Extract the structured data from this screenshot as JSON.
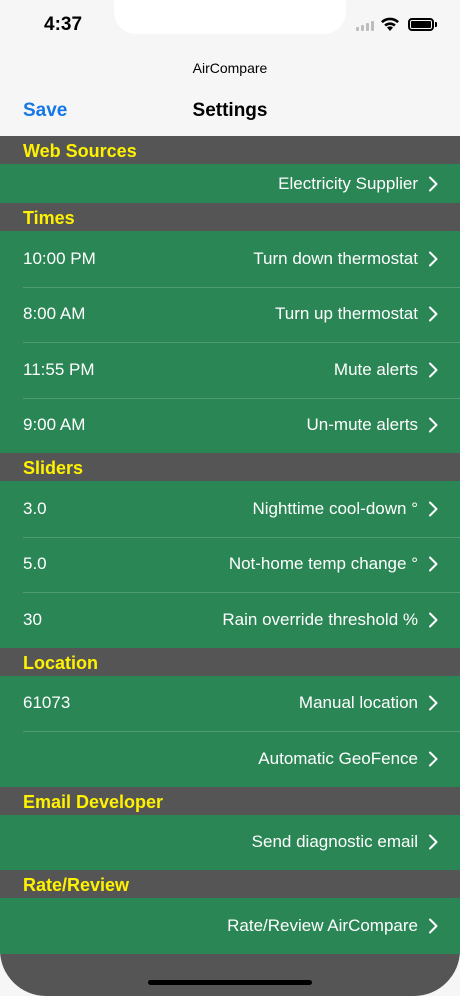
{
  "status_bar": {
    "time": "4:37"
  },
  "app_name": "AirCompare",
  "nav": {
    "save_label": "Save",
    "title": "Settings"
  },
  "sections": [
    {
      "header": "Web Sources",
      "rows": [
        {
          "value": "",
          "label": "Electricity Supplier"
        }
      ]
    },
    {
      "header": "Times",
      "rows": [
        {
          "value": "10:00 PM",
          "label": "Turn down thermostat"
        },
        {
          "value": "8:00 AM",
          "label": "Turn up thermostat"
        },
        {
          "value": "11:55 PM",
          "label": "Mute alerts"
        },
        {
          "value": "9:00 AM",
          "label": "Un-mute alerts"
        }
      ]
    },
    {
      "header": "Sliders",
      "rows": [
        {
          "value": "3.0",
          "label": "Nighttime cool-down °"
        },
        {
          "value": "5.0",
          "label": "Not-home temp change °"
        },
        {
          "value": "30",
          "label": "Rain override threshold %"
        }
      ]
    },
    {
      "header": "Location",
      "rows": [
        {
          "value": "61073",
          "label": "Manual location"
        },
        {
          "value": "",
          "label": "Automatic GeoFence"
        }
      ]
    },
    {
      "header": "Email Developer",
      "rows": [
        {
          "value": "",
          "label": "Send diagnostic email"
        }
      ]
    },
    {
      "header": "Rate/Review",
      "rows": [
        {
          "value": "",
          "label": "Rate/Review AirCompare"
        }
      ]
    }
  ],
  "colors": {
    "accent": "#1677e8",
    "header_text": "#fff200",
    "row_bg": "#2a8655",
    "section_bg": "#555555"
  }
}
